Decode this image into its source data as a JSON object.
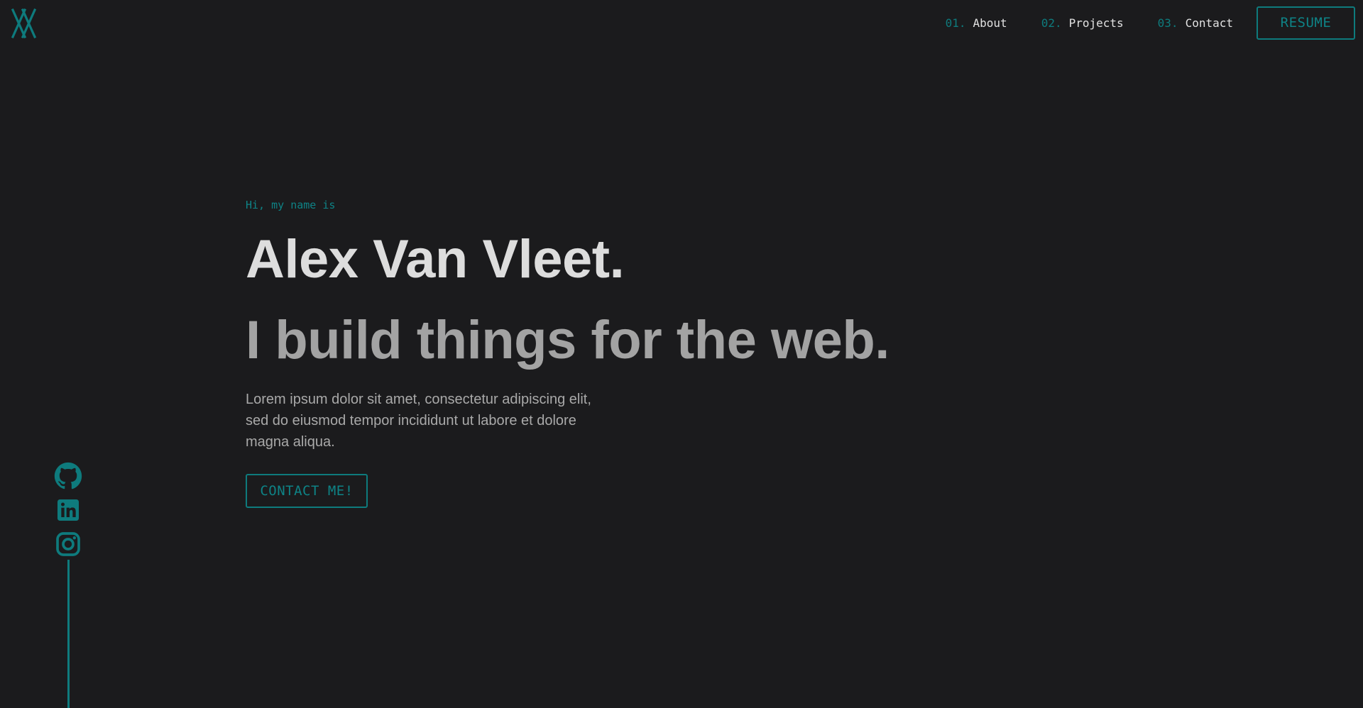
{
  "nav": {
    "items": [
      {
        "num": "01.",
        "label": "About"
      },
      {
        "num": "02.",
        "label": "Projects"
      },
      {
        "num": "03.",
        "label": "Contact"
      }
    ],
    "resume_label": "RESUME"
  },
  "hero": {
    "greeting": "Hi, my name is",
    "name": "Alex Van Vleet.",
    "tagline": "I build things for the web.",
    "bio": "Lorem ipsum dolor sit amet, consectetur adipiscing elit, sed do eiusmod tempor incididunt ut labore et dolore magna aliqua.",
    "contact_label": "CONTACT ME!"
  },
  "social": [
    {
      "icon": "github-icon"
    },
    {
      "icon": "linkedin-icon"
    },
    {
      "icon": "instagram-icon"
    }
  ],
  "colors": {
    "background": "#1b1b1d",
    "accent": "#0e7b7d",
    "heading": "#dddddd",
    "subheading": "#a3a3a3",
    "body_text": "#a9a9a9"
  }
}
